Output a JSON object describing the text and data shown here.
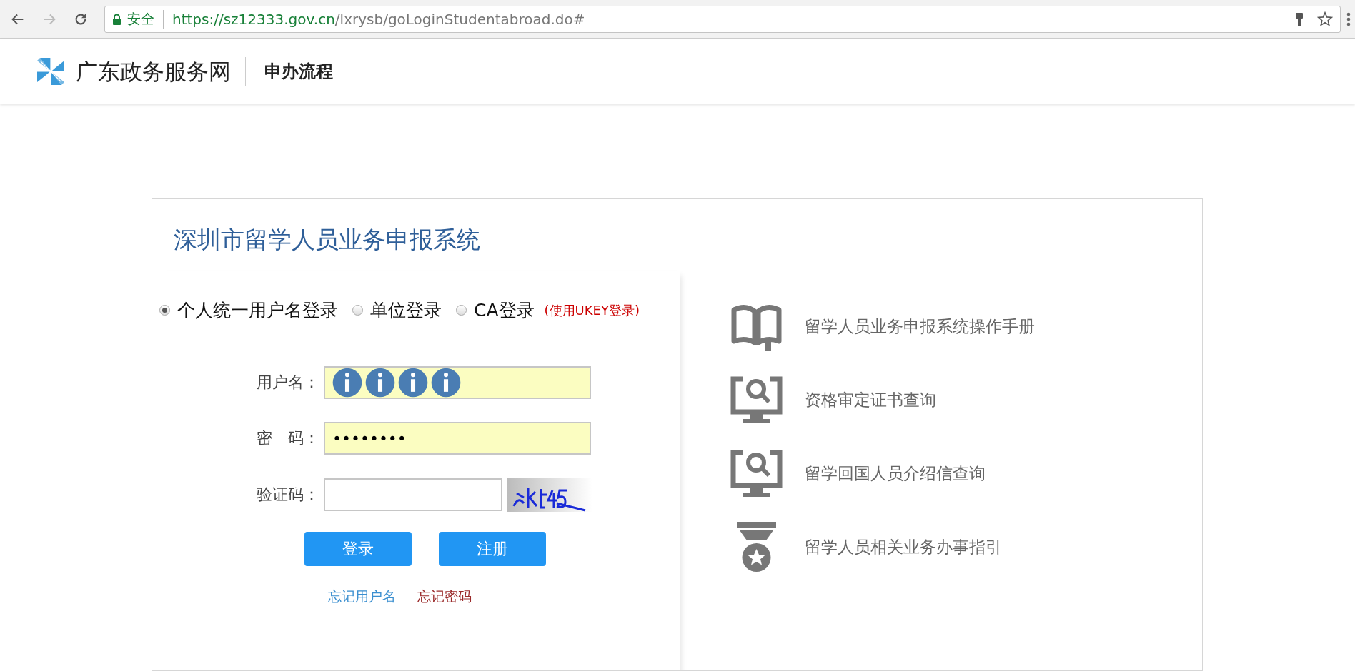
{
  "browser": {
    "security_label": "安全",
    "url_origin": "https://sz12333.gov.cn",
    "url_path": "/lxrysb/goLoginStudentabroad.do#"
  },
  "header": {
    "site_name": "广东政务服务网",
    "nav_link": "申办流程"
  },
  "login": {
    "title": "深圳市留学人员业务申报系统",
    "login_types": [
      {
        "label": "个人统一用户名登录",
        "selected": true
      },
      {
        "label": "单位登录",
        "selected": false
      },
      {
        "label": "CA登录",
        "selected": false,
        "note": "(使用UKEY登录)"
      }
    ],
    "fields": [
      {
        "kind": "text",
        "label": "用户名：",
        "autofilled": true,
        "redacted": true
      },
      {
        "kind": "password",
        "label": "密　码：",
        "value": "••••••••",
        "autofilled": true
      },
      {
        "kind": "captcha",
        "label": "验证码：",
        "autofilled": false
      }
    ],
    "buttons": [
      "登录",
      "注册"
    ],
    "links": [
      {
        "label": "忘记用户名",
        "color": "#3b8fd0"
      },
      {
        "label": "忘记密码",
        "color": "#9b2b2b"
      }
    ]
  },
  "services": [
    {
      "kind": "book",
      "label": "留学人员业务申报系统操作手册"
    },
    {
      "kind": "monitor-search",
      "label": "资格审定证书查询"
    },
    {
      "kind": "monitor-search",
      "label": "留学回国人员介绍信查询"
    },
    {
      "kind": "medal",
      "label": "留学人员相关业务办事指引"
    }
  ]
}
